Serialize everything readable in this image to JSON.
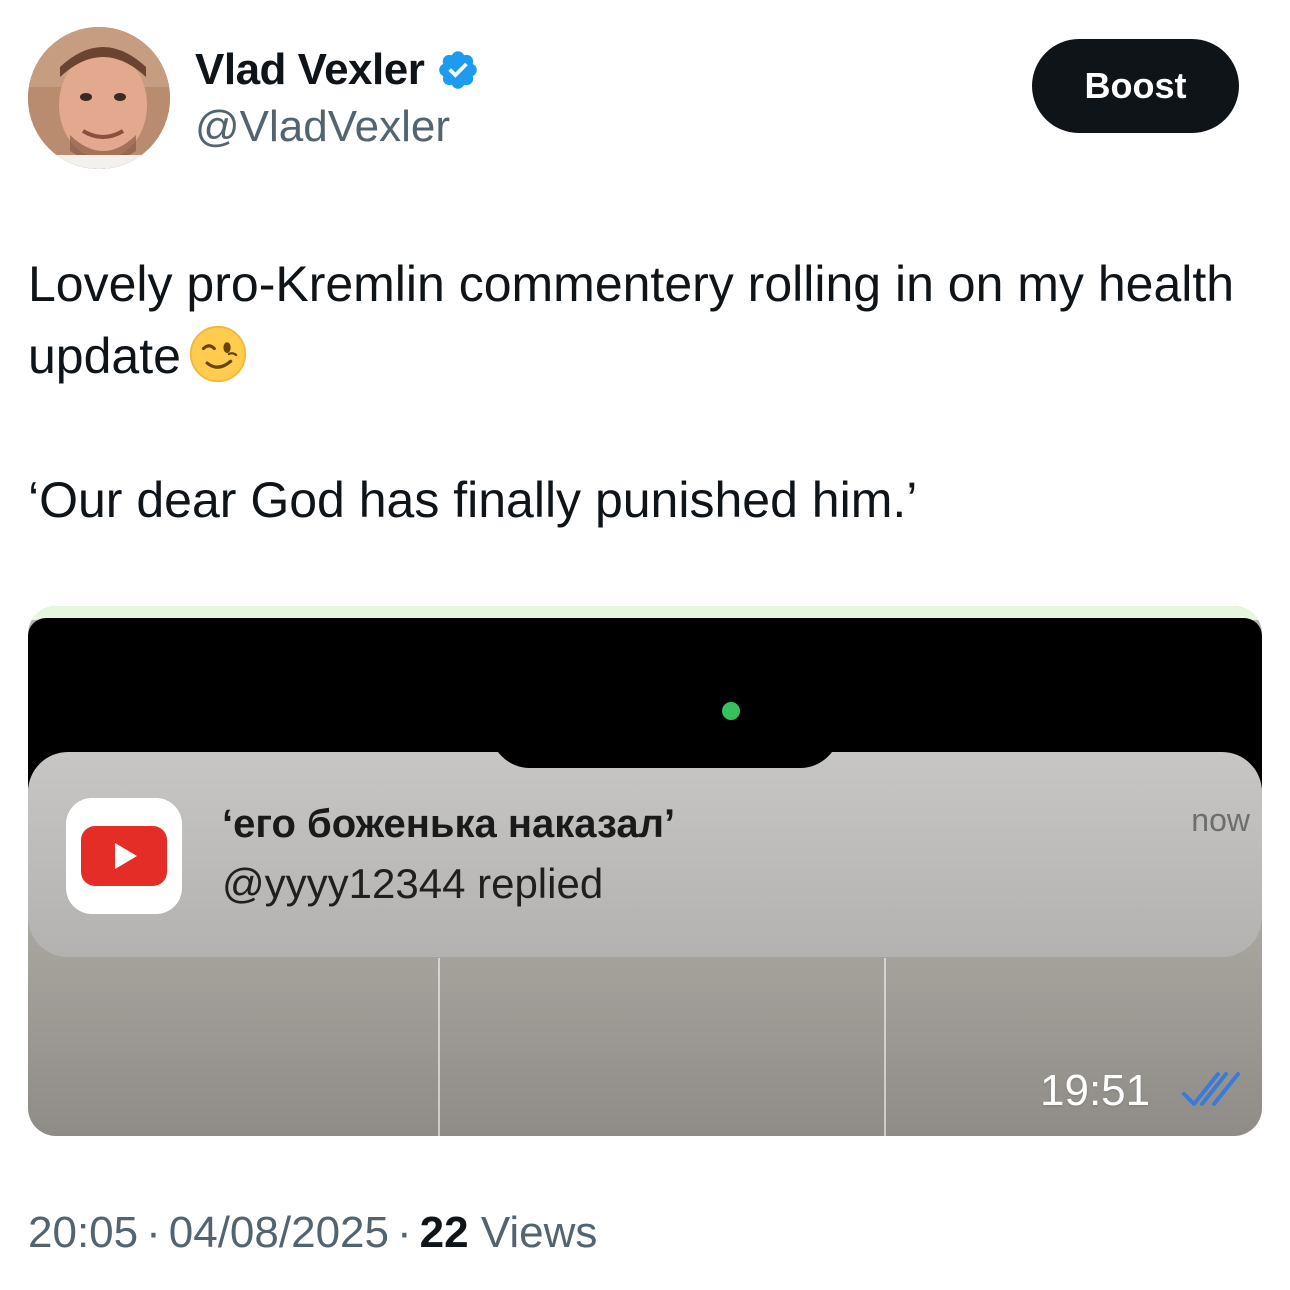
{
  "author": {
    "display_name": "Vlad Vexler",
    "handle": "@VladVexler",
    "verified": true
  },
  "actions": {
    "boost_label": "Boost"
  },
  "tweet": {
    "line1": "Lovely pro-Kremlin commentery rolling in on my health update",
    "emoji": "winking-face",
    "quote": "‘Our dear God has finally punished him.’"
  },
  "media": {
    "notification": {
      "app_icon": "youtube-icon",
      "title": "‘его боженька наказал’",
      "subtitle": "@yyyy12344 replied",
      "time": "now"
    },
    "message_time": "19:51",
    "read_status_icon": "double-check-icon"
  },
  "meta": {
    "time": "20:05",
    "date": "04/08/2025",
    "views_count": "22",
    "views_label": "Views"
  },
  "colors": {
    "primary_text": "#0f1419",
    "secondary_text": "#536471",
    "verified_blue": "#1d9bf0",
    "youtube_red": "#e52d27",
    "ticks_blue": "#3b7bd8"
  }
}
